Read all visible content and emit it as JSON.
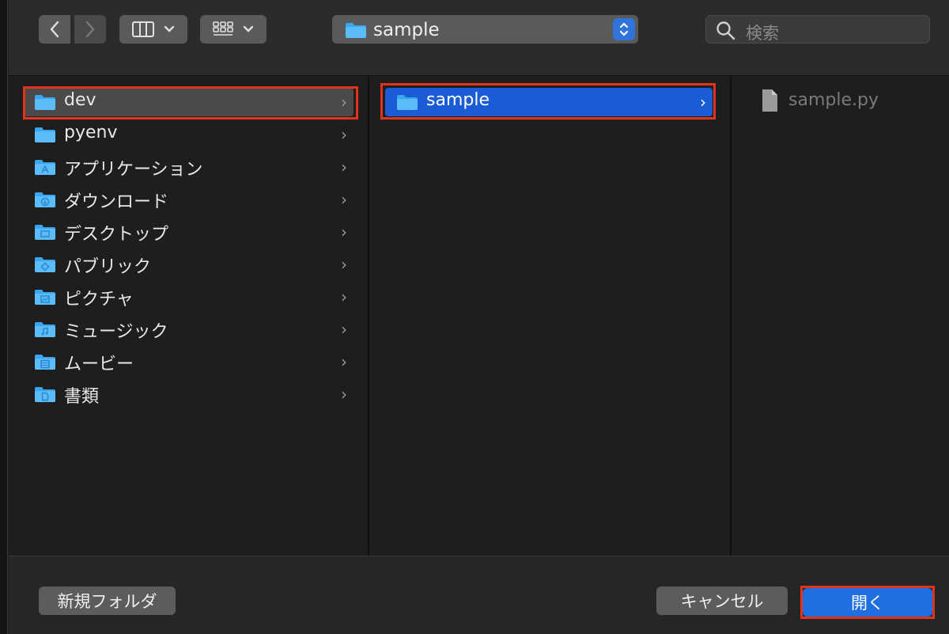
{
  "toolbar": {
    "path_label": "sample",
    "search_placeholder": "検索"
  },
  "columns": {
    "sidebar": [
      {
        "label": "dev",
        "icon": "folder-icon",
        "selected": true
      },
      {
        "label": "pyenv",
        "icon": "folder-icon"
      },
      {
        "label": "アプリケーション",
        "icon": "applications-folder-icon"
      },
      {
        "label": "ダウンロード",
        "icon": "downloads-folder-icon"
      },
      {
        "label": "デスクトップ",
        "icon": "desktop-folder-icon"
      },
      {
        "label": "パブリック",
        "icon": "public-folder-icon"
      },
      {
        "label": "ピクチャ",
        "icon": "pictures-folder-icon"
      },
      {
        "label": "ミュージック",
        "icon": "music-folder-icon"
      },
      {
        "label": "ムービー",
        "icon": "movies-folder-icon"
      },
      {
        "label": "書類",
        "icon": "documents-folder-icon"
      }
    ],
    "second": [
      {
        "label": "sample",
        "icon": "folder-icon",
        "selected": true
      }
    ],
    "third": [
      {
        "label": "sample.py",
        "icon": "file-icon"
      }
    ]
  },
  "footer": {
    "new_folder": "新規フォルダ",
    "cancel": "キャンセル",
    "open": "開く"
  },
  "colors": {
    "accent": "#1a5cd6",
    "highlight_border": "#e2341d",
    "folder": "#3aa6f0"
  }
}
